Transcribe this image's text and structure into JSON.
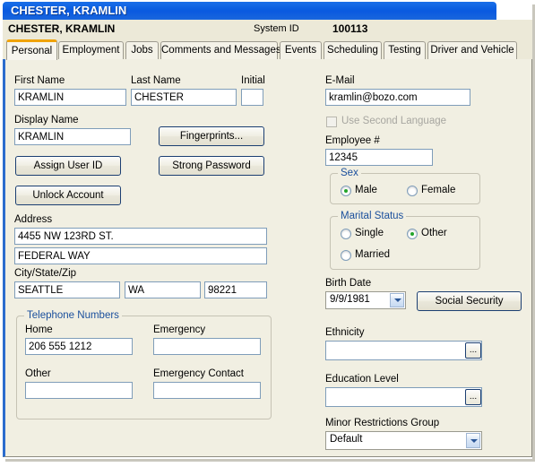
{
  "window": {
    "title": "CHESTER, KRAMLIN"
  },
  "header": {
    "name": "CHESTER,  KRAMLIN",
    "system_id_label": "System ID",
    "system_id_value": "100113"
  },
  "tabs": [
    {
      "label": "Personal",
      "active": true
    },
    {
      "label": "Employment",
      "active": false
    },
    {
      "label": "Jobs",
      "active": false
    },
    {
      "label": "Comments and Messages",
      "active": false
    },
    {
      "label": "Events",
      "active": false
    },
    {
      "label": "Scheduling",
      "active": false
    },
    {
      "label": "Testing",
      "active": false
    },
    {
      "label": "Driver and Vehicle",
      "active": false
    }
  ],
  "left": {
    "first_name_label": "First Name",
    "first_name_value": "KRAMLIN",
    "last_name_label": "Last Name",
    "last_name_value": "CHESTER",
    "initial_label": "Initial",
    "initial_value": "",
    "display_name_label": "Display Name",
    "display_name_value": "KRAMLIN",
    "fingerprints_button": "Fingerprints...",
    "assign_user_id_button": "Assign User ID",
    "strong_password_button": "Strong Password",
    "unlock_account_button": "Unlock Account",
    "address_label": "Address",
    "address_line1": "4455 NW 123RD ST.",
    "address_line2": "FEDERAL WAY",
    "city_state_zip_label": "City/State/Zip",
    "city_value": "SEATTLE",
    "state_value": "WA",
    "zip_value": "98221",
    "telephone_group_title": "Telephone Numbers",
    "home_label": "Home",
    "home_value": "206 555 1212",
    "emergency_label": "Emergency",
    "emergency_value": "",
    "other_label": "Other",
    "other_value": "",
    "emergency_contact_label": "Emergency Contact",
    "emergency_contact_value": ""
  },
  "right": {
    "email_label": "E-Mail",
    "email_value": "kramlin@bozo.com",
    "second_language_label": "Use Second Language",
    "employee_num_label": "Employee #",
    "employee_num_value": "12345",
    "sex_group_title": "Sex",
    "sex_male_label": "Male",
    "sex_female_label": "Female",
    "sex_selected": "Male",
    "marital_group_title": "Marital Status",
    "marital_single_label": "Single",
    "marital_other_label": "Other",
    "marital_married_label": "Married",
    "marital_selected": "Other",
    "birth_date_label": "Birth Date",
    "birth_date_value": "9/9/1981",
    "social_security_button": "Social Security",
    "ethnicity_label": "Ethnicity",
    "ethnicity_value": "",
    "education_label": "Education Level",
    "education_value": "",
    "minor_restrictions_label": "Minor Restrictions Group",
    "minor_restrictions_value": "Default",
    "ellipsis_glyph": "..."
  },
  "colors": {
    "title_blue": "#0a5ce0",
    "panel_bg": "#f1efe2",
    "header_bg": "#ece9d8",
    "accent_orange": "#f0a30a",
    "group_label_blue": "#1a4f9c",
    "radio_dot_green": "#23a52a",
    "panel_left_border": "#2b6ccd"
  }
}
